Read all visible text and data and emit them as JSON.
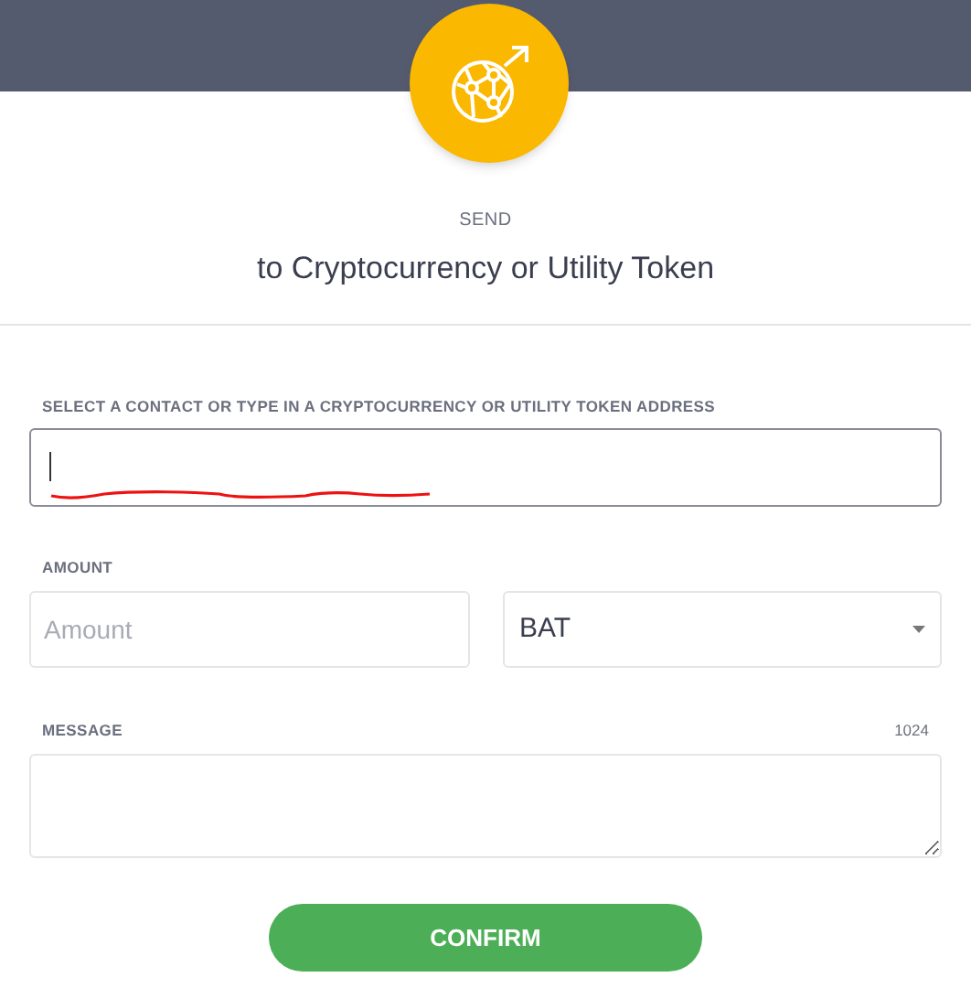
{
  "header": {
    "eyebrow": "SEND",
    "title": "to Cryptocurrency or Utility Token"
  },
  "address": {
    "label": "SELECT A CONTACT OR TYPE IN A CRYPTOCURRENCY OR UTILITY TOKEN ADDRESS",
    "focused": true
  },
  "amount": {
    "label": "AMOUNT",
    "placeholder": "Amount"
  },
  "token": {
    "value": "BAT"
  },
  "message": {
    "label": "MESSAGE",
    "counter": "1024"
  },
  "confirm_button": {
    "label": "CONFIRM"
  }
}
